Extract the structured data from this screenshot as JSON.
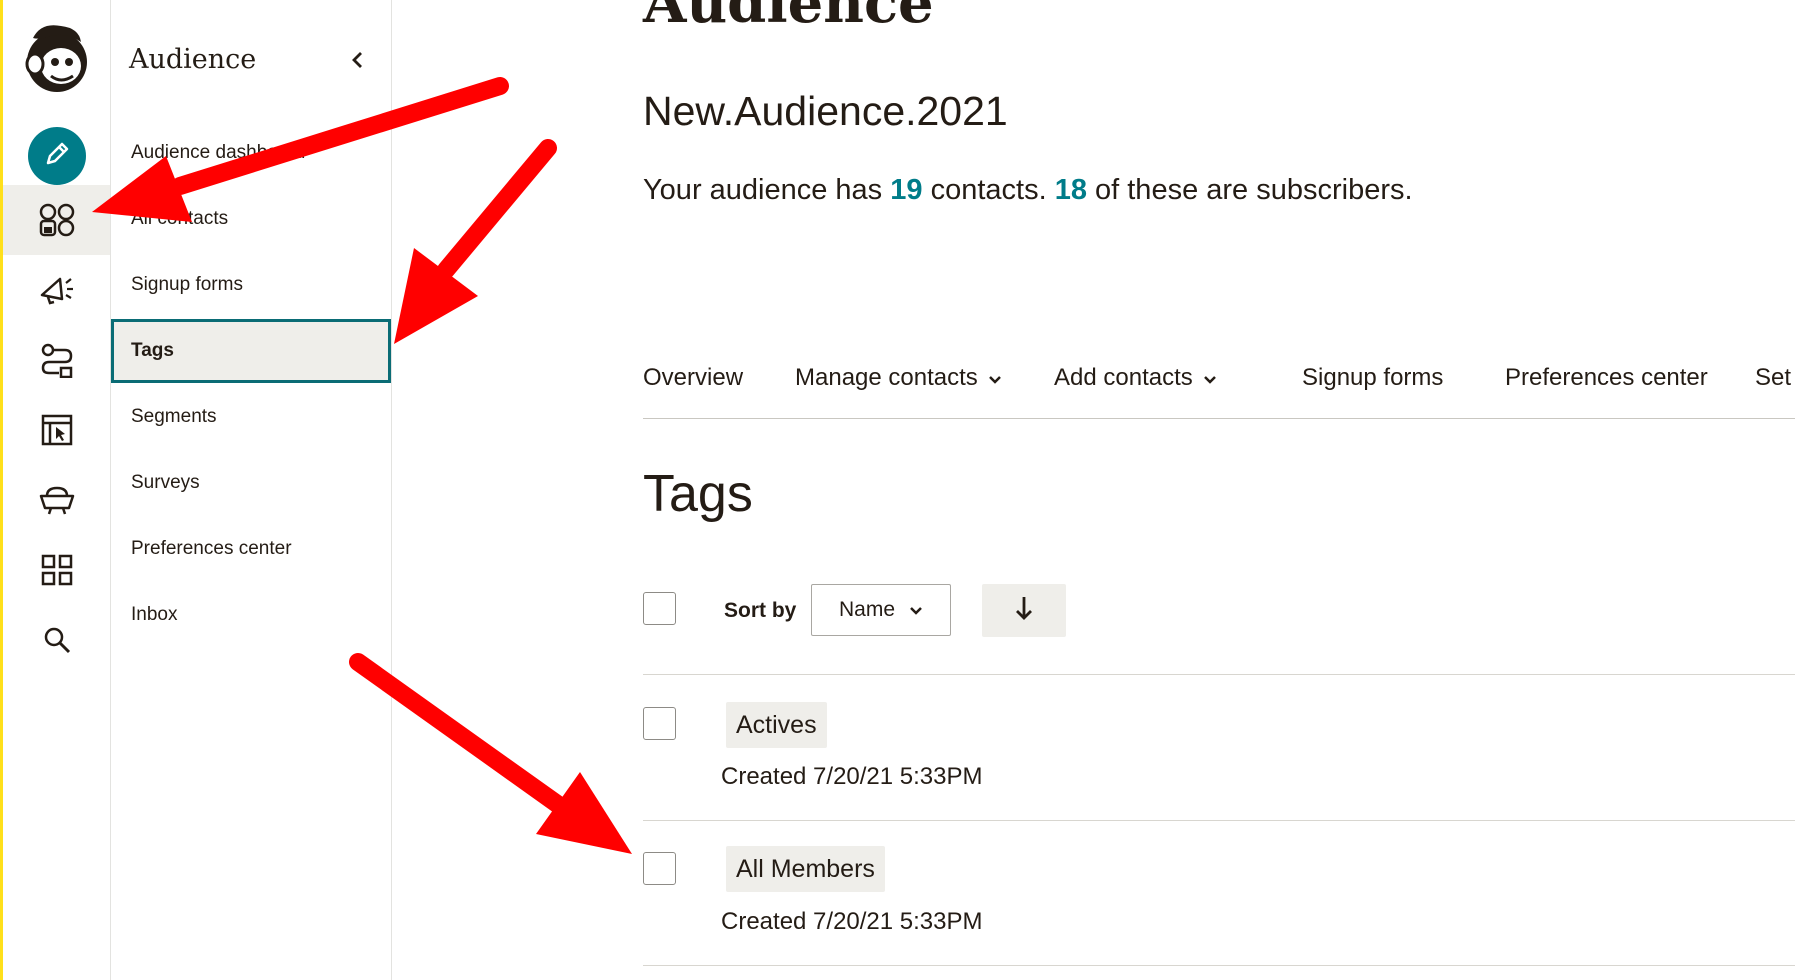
{
  "colors": {
    "accent": "#007c89",
    "brand_yellow": "#ffe01b",
    "annotation_red": "#ff0000"
  },
  "rail": {
    "logo_icon": "mailchimp-freddie-logo",
    "items": [
      {
        "icon": "pencil-create-icon"
      },
      {
        "icon": "audience-icon",
        "active": true
      },
      {
        "icon": "megaphone-campaigns-icon"
      },
      {
        "icon": "automations-icon"
      },
      {
        "icon": "website-icon"
      },
      {
        "icon": "content-studio-icon"
      },
      {
        "icon": "integrations-grid-icon"
      },
      {
        "icon": "search-icon"
      }
    ]
  },
  "subnav": {
    "title": "Audience",
    "items": [
      {
        "label": "Audience dashboard"
      },
      {
        "label": "All contacts"
      },
      {
        "label": "Signup forms"
      },
      {
        "label": "Tags",
        "active": true
      },
      {
        "label": "Segments"
      },
      {
        "label": "Surveys"
      },
      {
        "label": "Preferences center"
      },
      {
        "label": "Inbox"
      }
    ]
  },
  "main": {
    "title": "Audience",
    "audience_name": "New.Audience.2021",
    "summary": {
      "prefix": "Your audience has ",
      "contacts": "19",
      "middle": " contacts. ",
      "subscribers": "18",
      "suffix": " of these are subscribers."
    },
    "tabs": [
      {
        "label": "Overview",
        "dropdown": false
      },
      {
        "label": "Manage contacts",
        "dropdown": true
      },
      {
        "label": "Add contacts",
        "dropdown": true
      },
      {
        "label": "Signup forms",
        "dropdown": false
      },
      {
        "label": "Preferences center",
        "dropdown": false
      },
      {
        "label": "Set",
        "dropdown": false
      }
    ],
    "section_title": "Tags",
    "sort": {
      "label": "Sort by",
      "value": "Name",
      "direction_icon": "arrow-down-icon"
    },
    "tags": [
      {
        "name": "Actives",
        "created": "Created 7/20/21 5:33PM"
      },
      {
        "name": "All Members",
        "created": "Created 7/20/21 5:33PM"
      }
    ]
  }
}
